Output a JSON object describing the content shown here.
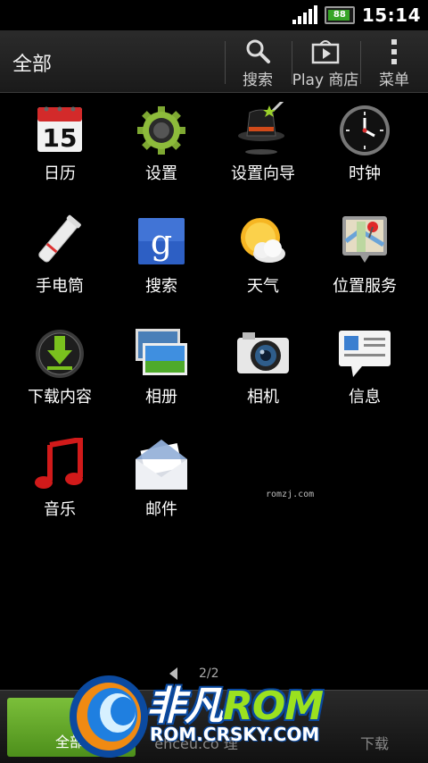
{
  "status_bar": {
    "battery": "88",
    "time": "15:14"
  },
  "action_bar": {
    "title": "全部",
    "search_label": "搜索",
    "play_label": "Play 商店",
    "menu_label": "菜单"
  },
  "apps": [
    {
      "label": "日历",
      "icon": "calendar-icon",
      "day": "15"
    },
    {
      "label": "设置",
      "icon": "gear-icon"
    },
    {
      "label": "设置向导",
      "icon": "magic-hat-icon"
    },
    {
      "label": "时钟",
      "icon": "clock-icon"
    },
    {
      "label": "手电筒",
      "icon": "flashlight-icon"
    },
    {
      "label": "搜索",
      "icon": "google-search-icon",
      "glyph": "g"
    },
    {
      "label": "天气",
      "icon": "weather-icon"
    },
    {
      "label": "位置服务",
      "icon": "location-map-icon"
    },
    {
      "label": "下载内容",
      "icon": "download-icon"
    },
    {
      "label": "相册",
      "icon": "gallery-icon"
    },
    {
      "label": "相机",
      "icon": "camera-icon"
    },
    {
      "label": "信息",
      "icon": "messages-icon"
    },
    {
      "label": "音乐",
      "icon": "music-icon"
    },
    {
      "label": "邮件",
      "icon": "mail-icon"
    }
  ],
  "watermark_small": "romzj.com",
  "pager": {
    "text": "2/2"
  },
  "dock": {
    "all_label": "全部",
    "item2": "ehceu.co 理",
    "item3": "下载"
  },
  "logo": {
    "line1_a": "非凡",
    "line1_b": "ROM",
    "line2": "ROM.CRSKY.COM"
  },
  "colors": {
    "dock_active": "#6aaa2c",
    "battery_fill": "#37a526",
    "logo_green": "#9be11f",
    "logo_blue": "#0b4aa0"
  }
}
